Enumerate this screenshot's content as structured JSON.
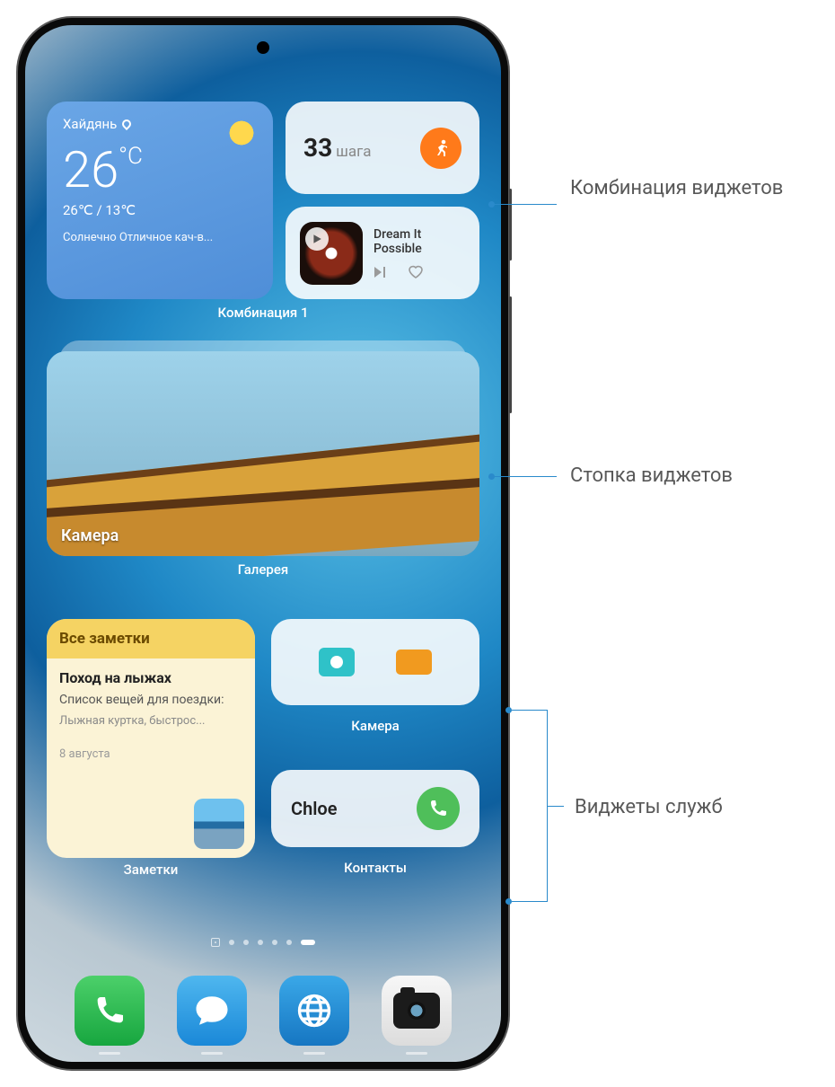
{
  "combo": {
    "label": "Комбинация 1",
    "weather": {
      "location": "Хайдянь",
      "temp": "26",
      "unit": "°C",
      "high": "26℃",
      "low": "13℃",
      "condition": "Солнечно  Отличное кач-в..."
    },
    "steps": {
      "count": "33",
      "label": "шага"
    },
    "music": {
      "title": "Dream It Possible"
    }
  },
  "stack": {
    "caption": "Камера",
    "label": "Галерея"
  },
  "notes": {
    "header": "Все заметки",
    "title": "Поход на лыжах",
    "subtitle": "Список вещей для поездки:",
    "items": "Лыжная куртка, быстрос...",
    "date": "8 августа",
    "label": "Заметки"
  },
  "services": {
    "camera_label": "Камера",
    "contact": {
      "name": "Chloe",
      "label": "Контакты"
    }
  },
  "callouts": {
    "combo": "Комбинация виджетов",
    "stack": "Стопка виджетов",
    "service": "Виджеты служб"
  },
  "colors": {
    "accent": "#2a8acb"
  }
}
